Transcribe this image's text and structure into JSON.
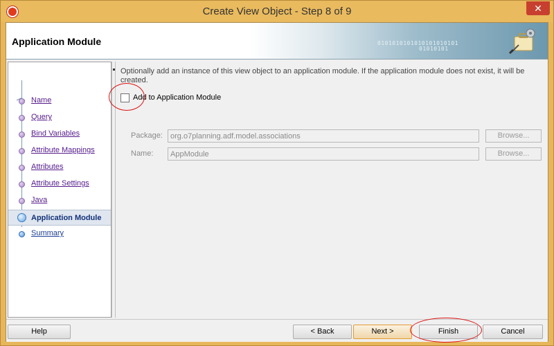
{
  "window": {
    "title": "Create View Object - Step 8 of 9",
    "close_glyph": "✕"
  },
  "banner": {
    "title": "Application Module",
    "binary_line1": "0101010101010101010101",
    "binary_line2": "01010101"
  },
  "nav": {
    "items": [
      {
        "label": "Name",
        "state": "visited",
        "icon": "step-bullet-icon"
      },
      {
        "label": "Query",
        "state": "visited",
        "icon": "step-bullet-icon"
      },
      {
        "label": "Bind Variables",
        "state": "visited",
        "icon": "step-bullet-icon"
      },
      {
        "label": "Attribute Mappings",
        "state": "visited",
        "icon": "step-bullet-icon"
      },
      {
        "label": "Attributes",
        "state": "visited",
        "icon": "step-bullet-icon"
      },
      {
        "label": "Attribute Settings",
        "state": "visited",
        "icon": "step-bullet-icon"
      },
      {
        "label": "Java",
        "state": "visited",
        "icon": "step-bullet-icon"
      },
      {
        "label": "Application Module",
        "state": "current",
        "icon": "step-bullet-icon"
      },
      {
        "label": "Summary",
        "state": "future",
        "icon": "step-bullet-icon"
      }
    ]
  },
  "content": {
    "description": "Optionally add an instance of this view object to an application module.  If the application module does not exist, it will be created.",
    "add_checkbox_label": "Add to Application Module",
    "add_checkbox_checked": false,
    "package_label": "Package:",
    "package_value": "org.o7planning.adf.model.associations",
    "name_label": "Name:",
    "name_value": "AppModule",
    "browse_label": "Browse..."
  },
  "footer": {
    "help": "Help",
    "back": "< Back",
    "next": "Next >",
    "finish": "Finish",
    "cancel": "Cancel"
  },
  "colors": {
    "title_bar": "#e9ba5e",
    "close_button": "#c7402f",
    "annotation": "#dd1111"
  }
}
